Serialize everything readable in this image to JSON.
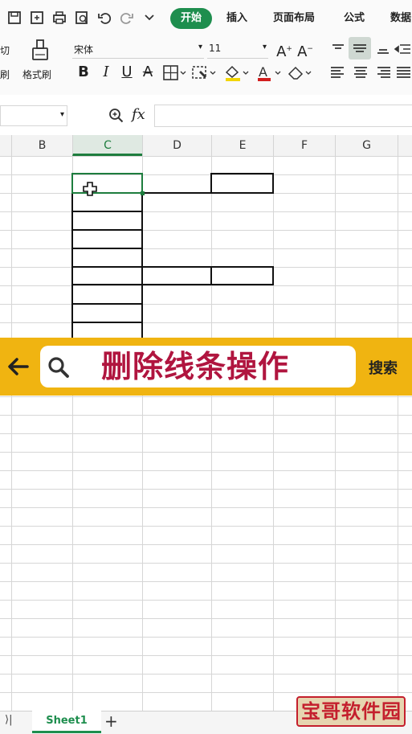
{
  "ribbon": {
    "tabs": [
      "开始",
      "插入",
      "页面布局",
      "公式",
      "数据"
    ],
    "clipboard_cut_label": "切",
    "clipboard_brush_label": "刷",
    "format_painter_label": "格式刷",
    "font_name": "宋体",
    "font_size": "11"
  },
  "formula_bar": {
    "name_box": "",
    "fx_label": "fx",
    "formula_value": ""
  },
  "columns": [
    "B",
    "C",
    "D",
    "E",
    "F",
    "G"
  ],
  "active_column": "C",
  "search_banner": {
    "text": "删除线条操作",
    "search_button": "搜索"
  },
  "sheet_bar": {
    "first_sheet_label": "⟩|",
    "active_sheet": "Sheet1",
    "add_sheet": "+"
  },
  "watermark": "宝哥软件园",
  "colors": {
    "accent_green": "#1e8e4e",
    "banner_yellow": "#f0b411",
    "search_text": "#b0153f"
  }
}
